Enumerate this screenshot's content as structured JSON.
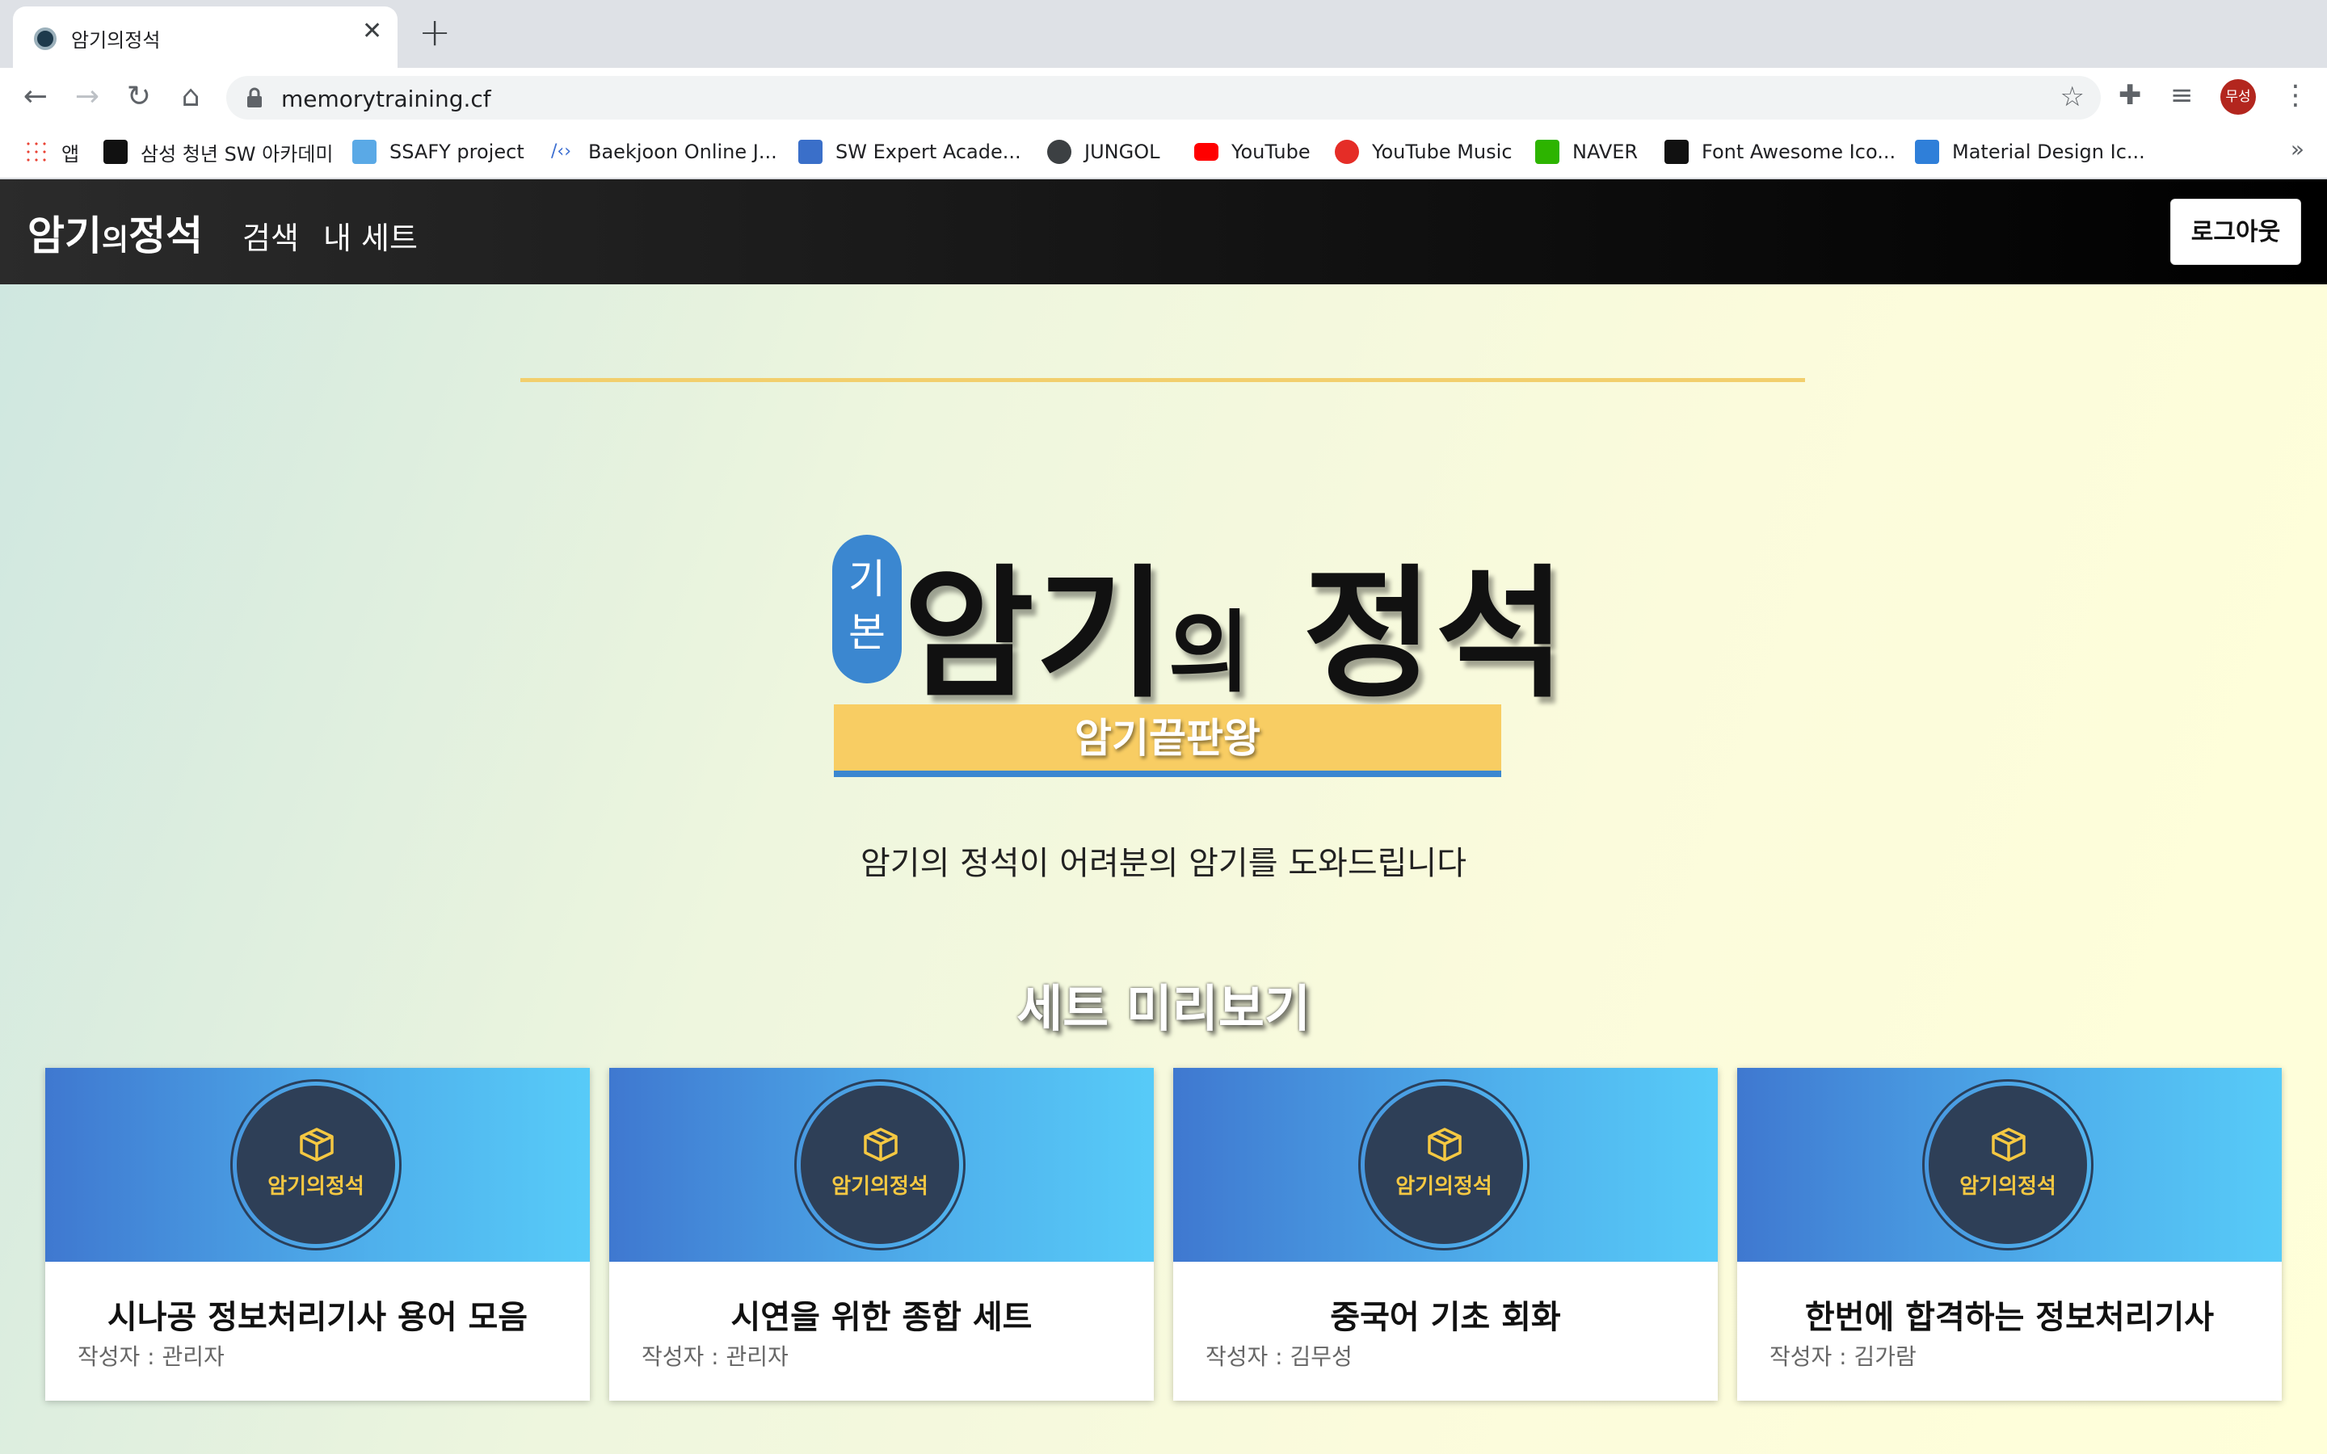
{
  "browser": {
    "tab_title": "암기의정석",
    "url": "memorytraining.cf",
    "profile_label": "무성",
    "bookmarks": [
      {
        "label": "앱",
        "icon": "apps-grid-icon"
      },
      {
        "label": "삼성 청년 SW 아카데미",
        "icon": "ssafy-icon"
      },
      {
        "label": "SSAFY project",
        "icon": "ssafy-project-icon"
      },
      {
        "label": "Baekjoon Online J...",
        "icon": "code-icon"
      },
      {
        "label": "SW Expert Acade...",
        "icon": "swea-icon"
      },
      {
        "label": "JUNGOL",
        "icon": "globe-icon"
      },
      {
        "label": "YouTube",
        "icon": "youtube-icon"
      },
      {
        "label": "YouTube Music",
        "icon": "youtube-music-icon"
      },
      {
        "label": "NAVER",
        "icon": "naver-icon"
      },
      {
        "label": "Font Awesome Ico...",
        "icon": "flag-icon"
      },
      {
        "label": "Material Design Ic...",
        "icon": "material-icon"
      }
    ],
    "more_label": "»"
  },
  "site": {
    "logo_main": "암기",
    "logo_small": "의",
    "logo_end": "정석",
    "nav": {
      "search": "검색",
      "my_sets": "내 세트"
    },
    "logout": "로그아웃"
  },
  "hero": {
    "badge_line1": "기",
    "badge_line2": "본",
    "title_a": "암기",
    "title_small": "의",
    "title_b": " 정석",
    "banner": "암기끝판왕",
    "tagline": "암기의 정석이 어려분의 암기를 도와드립니다",
    "preview_title": "세트 미리보기"
  },
  "cards": [
    {
      "brand": "암기의정석",
      "title": "시나공 정보처리기사 용어 모음",
      "author": "작성자 : 관리자"
    },
    {
      "brand": "암기의정석",
      "title": "시연을 위한 종합 세트",
      "author": "작성자 : 관리자"
    },
    {
      "brand": "암기의정석",
      "title": "중국어 기초 회화",
      "author": "작성자 : 김무성"
    },
    {
      "brand": "암기의정석",
      "title": "한번에 합격하는 정보처리기사",
      "author": "작성자 : 김가람"
    }
  ],
  "colors": {
    "accent_blue": "#3b87d0",
    "banner_yellow": "#f8cd63",
    "nav_dark": "#111111",
    "card_circle": "#2e3f57",
    "card_brand": "#f5c842"
  }
}
